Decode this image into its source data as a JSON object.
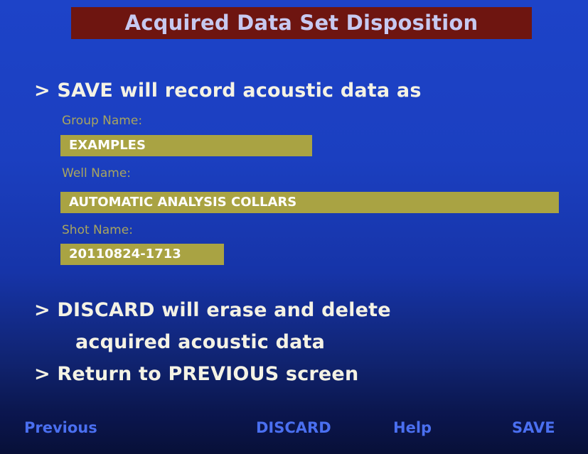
{
  "title": "Acquired Data Set Disposition",
  "save_line": "> SAVE will record acoustic data as",
  "fields": {
    "group": {
      "label": "Group Name:",
      "value": "EXAMPLES"
    },
    "well": {
      "label": "Well Name:",
      "value": "AUTOMATIC ANALYSIS COLLARS"
    },
    "shot": {
      "label": "Shot Name:",
      "value": "20110824-1713"
    }
  },
  "discard_line1": "> DISCARD will erase and delete",
  "discard_line2": "acquired acoustic data",
  "return_line": "> Return to PREVIOUS screen",
  "softkeys": {
    "previous": "Previous",
    "discard": "DISCARD",
    "help": "Help",
    "save": "SAVE"
  },
  "colors": {
    "background": "#1b3fc0",
    "title_bar": "#6e1510",
    "field_fill": "#a9a343",
    "softkey_text": "#4a6ff0"
  }
}
